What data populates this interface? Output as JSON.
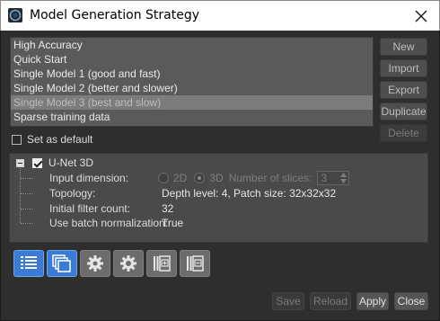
{
  "window": {
    "title": "Model Generation Strategy"
  },
  "strategies": [
    {
      "label": "High Accuracy",
      "selected": false
    },
    {
      "label": "Quick Start",
      "selected": false
    },
    {
      "label": "Single Model 1 (good and fast)",
      "selected": false
    },
    {
      "label": "Single Model 2 (better and slower)",
      "selected": false
    },
    {
      "label": "Single Model 3 (best and slow)",
      "selected": true
    },
    {
      "label": "Sparse training data",
      "selected": false
    }
  ],
  "side_buttons": {
    "new": "New",
    "import": "Import",
    "export": "Export",
    "duplicate": "Duplicate",
    "delete": "Delete"
  },
  "set_default": {
    "label": "Set as default",
    "checked": false
  },
  "model": {
    "name": "U-Net 3D",
    "enabled": true,
    "input_dimension": {
      "label": "Input dimension:",
      "opt_2d": "2D",
      "opt_3d": "3D",
      "selected": "3D",
      "slices_label": "Number of slices:",
      "slices_value": "3"
    },
    "topology": {
      "label": "Topology:",
      "value": "Depth level: 4, Patch size: 32x32x32"
    },
    "filter_count": {
      "label": "Initial filter count:",
      "value": "32"
    },
    "batch_norm": {
      "label": "Use batch normalization:",
      "value": "True"
    }
  },
  "toolbar": [
    {
      "icon": "list-view-icon",
      "state": "active"
    },
    {
      "icon": "stacked-windows-icon",
      "state": "active"
    },
    {
      "icon": "settings-gear-icon",
      "state": "inactive"
    },
    {
      "icon": "gear-icon",
      "state": "inactive"
    },
    {
      "icon": "add-panel-icon",
      "state": "inactive"
    },
    {
      "icon": "remove-panel-icon",
      "state": "inactive"
    }
  ],
  "footer": {
    "save": "Save",
    "reload": "Reload",
    "apply": "Apply",
    "close": "Close"
  },
  "colors": {
    "accent": "#3a7bd5",
    "list_bg": "#5a5a5a",
    "panel_bg": "#4a4a4a",
    "window_bg": "#2e2e2e"
  }
}
